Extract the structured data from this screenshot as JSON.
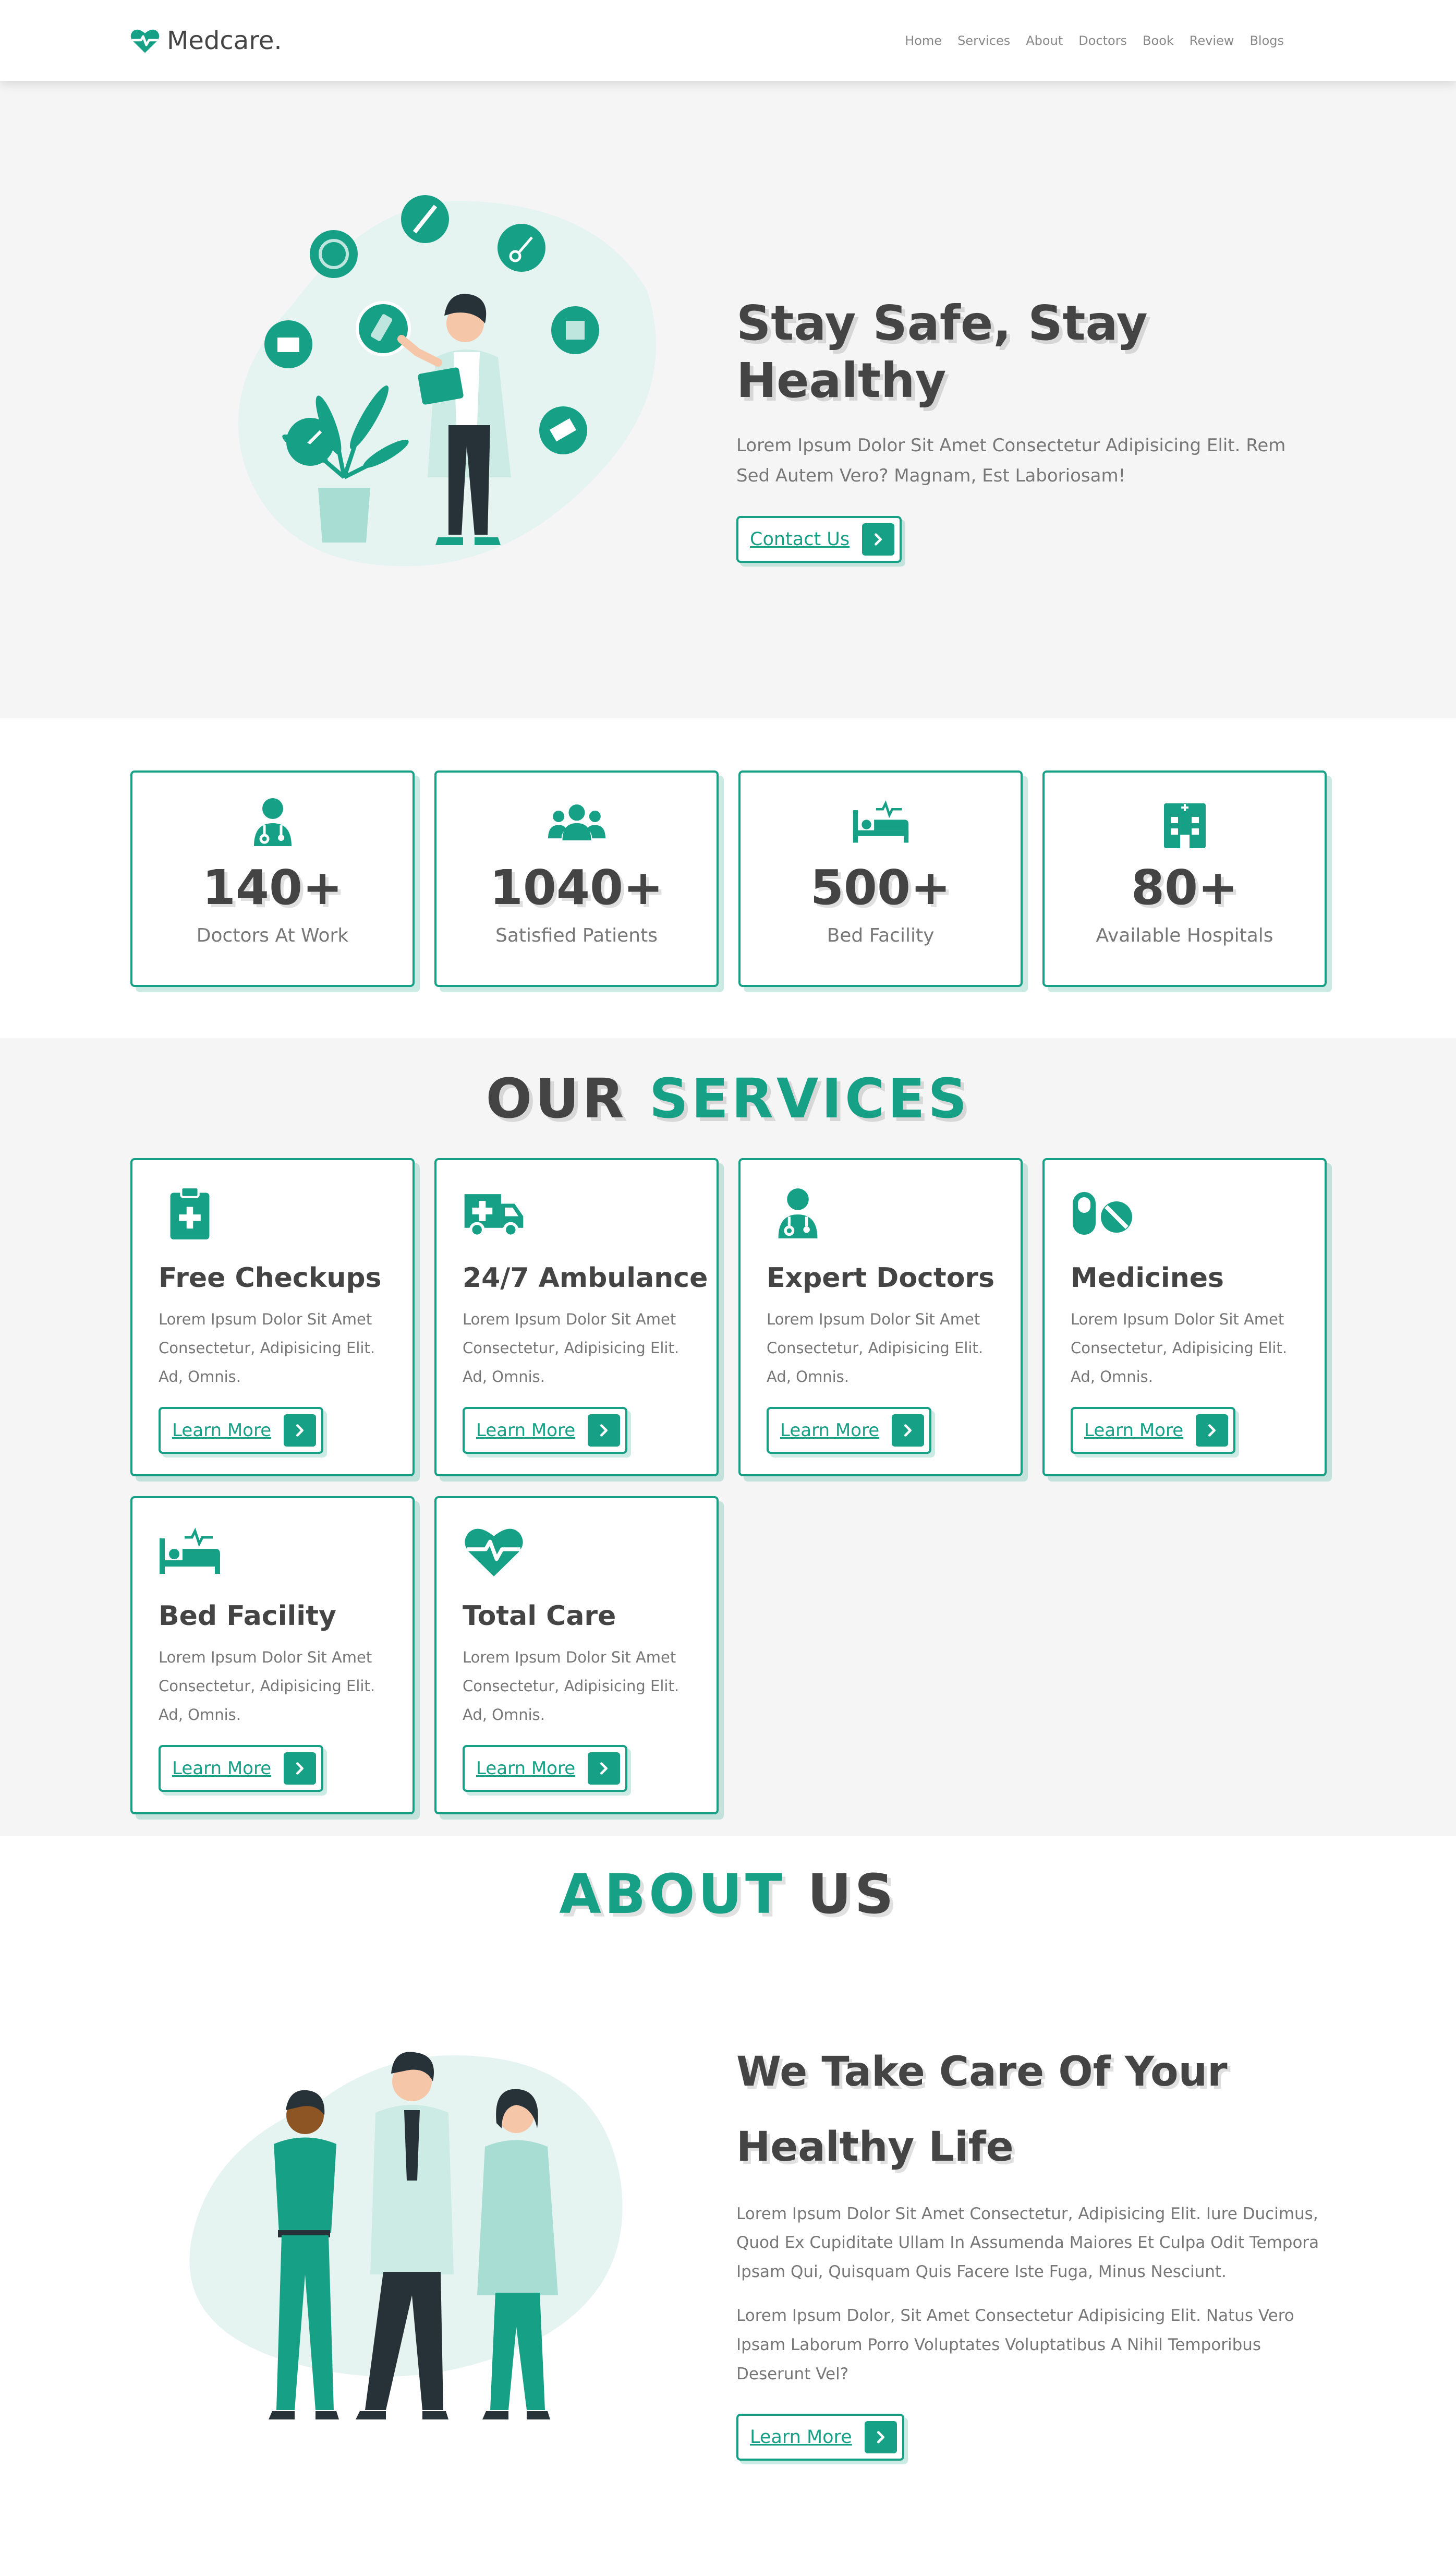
{
  "header": {
    "brand": "Medcare.",
    "nav": [
      "Home",
      "Services",
      "About",
      "Doctors",
      "Book",
      "Review",
      "Blogs"
    ]
  },
  "hero": {
    "title": "Stay Safe, Stay Healthy",
    "description": "Lorem Ipsum Dolor Sit Amet Consectetur Adipisicing Elit. Rem Sed Autem Vero? Magnam, Est Laboriosam!",
    "button": "Contact Us"
  },
  "stats": [
    {
      "icon": "doctor-icon",
      "number": "140+",
      "label": "Doctors At Work"
    },
    {
      "icon": "users-icon",
      "number": "1040+",
      "label": "Satisfied Patients"
    },
    {
      "icon": "bed-icon",
      "number": "500+",
      "label": "Bed Facility"
    },
    {
      "icon": "hospital-icon",
      "number": "80+",
      "label": "Available Hospitals"
    }
  ],
  "services": {
    "heading_a": "OUR",
    "heading_b": "SERVICES",
    "items": [
      {
        "icon": "clipboard-icon",
        "title": "Free Checkups",
        "desc": "Lorem Ipsum Dolor Sit Amet Consectetur, Adipisicing Elit. Ad, Omnis.",
        "button": "Learn More"
      },
      {
        "icon": "ambulance-icon",
        "title": "24/7 Ambulance",
        "desc": "Lorem Ipsum Dolor Sit Amet Consectetur, Adipisicing Elit. Ad, Omnis.",
        "button": "Learn More"
      },
      {
        "icon": "doctor-icon",
        "title": "Expert Doctors",
        "desc": "Lorem Ipsum Dolor Sit Amet Consectetur, Adipisicing Elit. Ad, Omnis.",
        "button": "Learn More"
      },
      {
        "icon": "pills-icon",
        "title": "Medicines",
        "desc": "Lorem Ipsum Dolor Sit Amet Consectetur, Adipisicing Elit. Ad, Omnis.",
        "button": "Learn More"
      },
      {
        "icon": "bed-icon",
        "title": "Bed Facility",
        "desc": "Lorem Ipsum Dolor Sit Amet Consectetur, Adipisicing Elit. Ad, Omnis.",
        "button": "Learn More"
      },
      {
        "icon": "heartbeat-icon",
        "title": "Total Care",
        "desc": "Lorem Ipsum Dolor Sit Amet Consectetur, Adipisicing Elit. Ad, Omnis.",
        "button": "Learn More"
      }
    ]
  },
  "about": {
    "heading_a": "ABOUT",
    "heading_b": "US",
    "title": "We Take Care Of Your Healthy Life",
    "p1": "Lorem Ipsum Dolor Sit Amet Consectetur, Adipisicing Elit. Iure Ducimus, Quod Ex Cupiditate Ullam In Assumenda Maiores Et Culpa Odit Tempora Ipsam Qui, Quisquam Quis Facere Iste Fuga, Minus Nesciunt.",
    "p2": "Lorem Ipsum Dolor, Sit Amet Consectetur Adipisicing Elit. Natus Vero Ipsam Laborum Porro Voluptates Voluptatibus A Nihil Temporibus Deserunt Vel?",
    "button": "Learn More"
  },
  "colors": {
    "accent": "#16a085",
    "text_dark": "#444444",
    "text_light": "#777777",
    "section_bg": "#f5f5f5"
  }
}
